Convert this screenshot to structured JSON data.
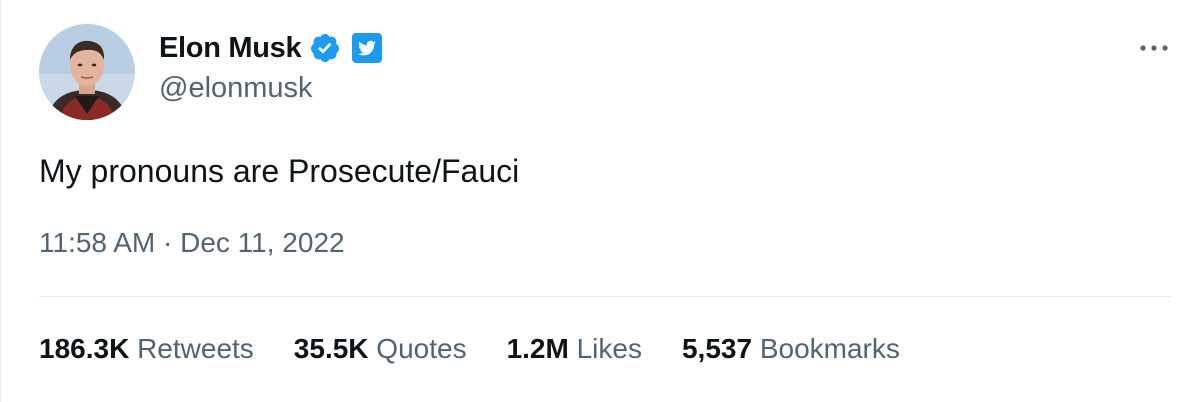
{
  "author": {
    "display_name": "Elon Musk",
    "handle": "@elonmusk",
    "avatar_icon": "profile-photo",
    "verified_icon": "verified-badge-icon",
    "affiliation_icon": "twitter-badge-icon"
  },
  "tweet": {
    "text": "My pronouns are Prosecute/Fauci",
    "timestamp": "11:58 AM · Dec 11, 2022"
  },
  "stats": {
    "retweets": {
      "value": "186.3K",
      "label": "Retweets"
    },
    "quotes": {
      "value": "35.5K",
      "label": "Quotes"
    },
    "likes": {
      "value": "1.2M",
      "label": "Likes"
    },
    "bookmarks": {
      "value": "5,537",
      "label": "Bookmarks"
    }
  },
  "colors": {
    "text_primary": "#0f1419",
    "text_secondary": "#536471",
    "verified_blue": "#1d9bf0",
    "divider": "#e6ecf0"
  }
}
